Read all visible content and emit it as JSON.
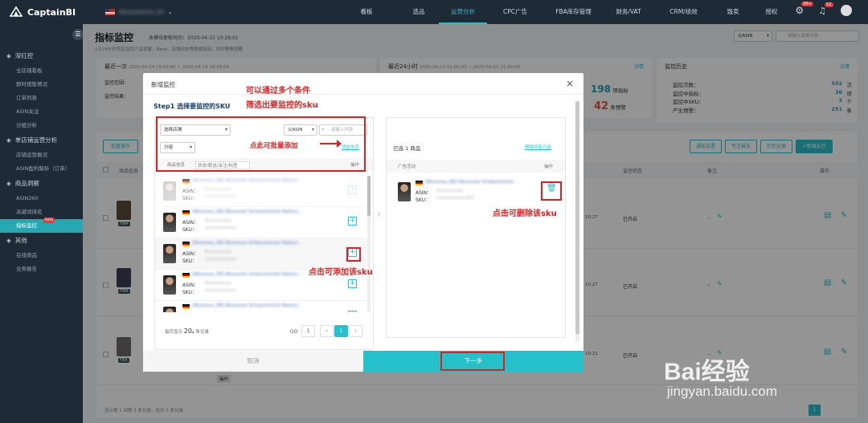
{
  "app": {
    "name": "CaptainBI",
    "store": "Gxxxxxxxxx_US"
  },
  "nav": [
    "看板",
    "选品",
    "运营分析",
    "CPC广告",
    "FBA库存管理",
    "财务/VAT",
    "CRM/绩效",
    "毁卖",
    "授权"
  ],
  "nav_active_index": 2,
  "badges": {
    "notify": "99+",
    "bell": "52"
  },
  "sidebar": {
    "groups": [
      {
        "label": "深红控",
        "items": [
          "全店铺看板",
          "即时销售情况",
          "订单列表",
          "ASIN关注",
          "分组分析"
        ]
      },
      {
        "label": "单店铺运营分析",
        "items": [
          "店铺运营概况",
          "ASIN盈利解析（订单）"
        ]
      },
      {
        "label": "商品洞察",
        "items": [
          "ASIN360",
          "关键词排名",
          "指标监控"
        ]
      },
      {
        "label": "其他",
        "items": [
          "在线商品",
          "业务报告"
        ]
      }
    ],
    "active_item": "指标监控",
    "beta": "beta"
  },
  "page": {
    "title": "指标监控",
    "update": "本模块更新时间：2020-04-15 10:28:01",
    "note": "1天24小时常驻监控产品销量、Rank、店铺动态等数据指标，即时预警提醒"
  },
  "summary": {
    "recent": {
      "label": "最近一次",
      "range": "2020-04-14 15:00:00 ~ 2020-04-14 18:59:59",
      "scope": "监控范围：",
      "result": "监控结果："
    },
    "day": {
      "label": "最近24小时",
      "range": "2020-04-14 11:00:00 ~ 2020-04-15 11:00:00",
      "detail": "详情",
      "metric_count": "198",
      "metric_unit": "项指标",
      "warn_count": "42",
      "warn_unit": "条预警"
    },
    "history": {
      "label": "监控历史",
      "detail": "详情",
      "rows": [
        {
          "k": "监控次数：",
          "v": "502",
          "u": "次"
        },
        {
          "k": "监控中指标：",
          "v": "36",
          "u": "项"
        },
        {
          "k": "监控中SKU：",
          "v": "3",
          "u": "个"
        },
        {
          "k": "产生预警：",
          "v": "251",
          "u": "条"
        }
      ]
    }
  },
  "search": {
    "type": "父ASIN",
    "placeholder": "请输入搜索内容"
  },
  "table_actions": {
    "batch": "批量操作",
    "notify": "通知设置",
    "rule": "专注报告",
    "history": "历史记录",
    "new": "+新增监控"
  },
  "table_head": {
    "check": "",
    "product": "商品信息",
    "status": "监控状态",
    "note": "备注",
    "op": "操作"
  },
  "table_rows": [
    {
      "fba": "FBM",
      "time": "10:27",
      "status": "已开启",
      "note": "--"
    },
    {
      "fba": "FBM",
      "time": "10:27",
      "status": "已开启",
      "note": "--"
    },
    {
      "fba": "FBA",
      "time": "10:21",
      "status": "已开启",
      "note": "--"
    }
  ],
  "table_footer": {
    "summary": "显示第 1 到第 3 条记录，总共 3 条记录",
    "page": "1",
    "op_label": "操作"
  },
  "modal": {
    "title": "新增监控",
    "step": "Step1 选择要监控的SKU",
    "filter_store": "选择店铺",
    "filter_type": "父ASIN",
    "filter_placeholder": "请输入内容",
    "filter_group": "分组",
    "batch_add": "添加全页",
    "col_product": "商品信息",
    "col_status": "状态/配送/关注/标签",
    "col_op": "操作",
    "products": [
      {
        "flag": "DE",
        "title": "[Wxxxxxx_DE] Wxxxxxxt Schlauchschal Halstuc...",
        "asin_label": "ASIN：",
        "asin": "Bxxxxxxxxx",
        "sku_label": "SKU：",
        "sku": "xxxxxxxxxxxx",
        "disabled": true
      },
      {
        "flag": "DE",
        "title": "[Wxxxxxx_DE] Wxxxxxxt Schlauchschal Halstuc...",
        "asin_label": "ASIN：",
        "asin": "Bxxxxxxxxx",
        "sku_label": "SKU：",
        "sku": "xxxxxxxxxxxx",
        "disabled": false
      },
      {
        "flag": "DE",
        "title": "[Wxxxxxx_DE] Wxxxxxxt Schlauchschal Halstuc...",
        "asin_label": "ASIN：",
        "asin": "Bxxxxxxxxx",
        "sku_label": "SKU：",
        "sku": "xxxxxxxxxxxx",
        "disabled": false
      },
      {
        "flag": "DE",
        "title": "[Wxxxxxx_DE] Wxxxxxxt Schlauchschal Halstuc...",
        "asin_label": "ASIN：",
        "asin": "Bxxxxxxxxx",
        "sku_label": "SKU：",
        "sku": "xxxxxxxxxxxx",
        "disabled": false
      },
      {
        "flag": "DE",
        "title": "[Wxxxxxx_DE] Wxxxxxxt Schlauchschal Halstuc...",
        "asin_label": "ASIN：",
        "asin": "Bxxxxxxxxx",
        "sku_label": "SKU：",
        "sku": "xxxxxxxxxxxx",
        "disabled": false
      }
    ],
    "pager": {
      "per_page_label": "每页显示",
      "per_page": "20",
      "unit": "条记录",
      "go": "GO",
      "go_value": "1",
      "prev": "‹",
      "page": "1",
      "next": "›"
    },
    "selected": {
      "count_label": "已选 1 商品",
      "remove_all": "删除所有已选",
      "col_product": "广告活动",
      "col_op": "操作",
      "item": {
        "flag": "DE",
        "title": "[Wxxxxxx_DE] Wxxxxxxt Schlauchschal...",
        "asin_label": "ASIN：",
        "asin": "Bxxxxxxxxx",
        "sku_label": "SKU：",
        "sku": "xxxxxxxxxxxxRD"
      }
    },
    "cancel": "取消",
    "next": "下一步"
  },
  "annotations": {
    "multi_filter_1": "可以通过多个条件",
    "multi_filter_2": "筛选出要监控的sku",
    "batch_add": "点此可批量添加",
    "add_sku": "点击可添加该sku",
    "remove_sku": "点击可删除该sku"
  },
  "watermark": {
    "text": "Bai经验",
    "url": "jingyan.baidu.com"
  },
  "colors": {
    "accent": "#25c0c9",
    "annotation": "#e02020",
    "sidebar": "#1e2a36"
  }
}
